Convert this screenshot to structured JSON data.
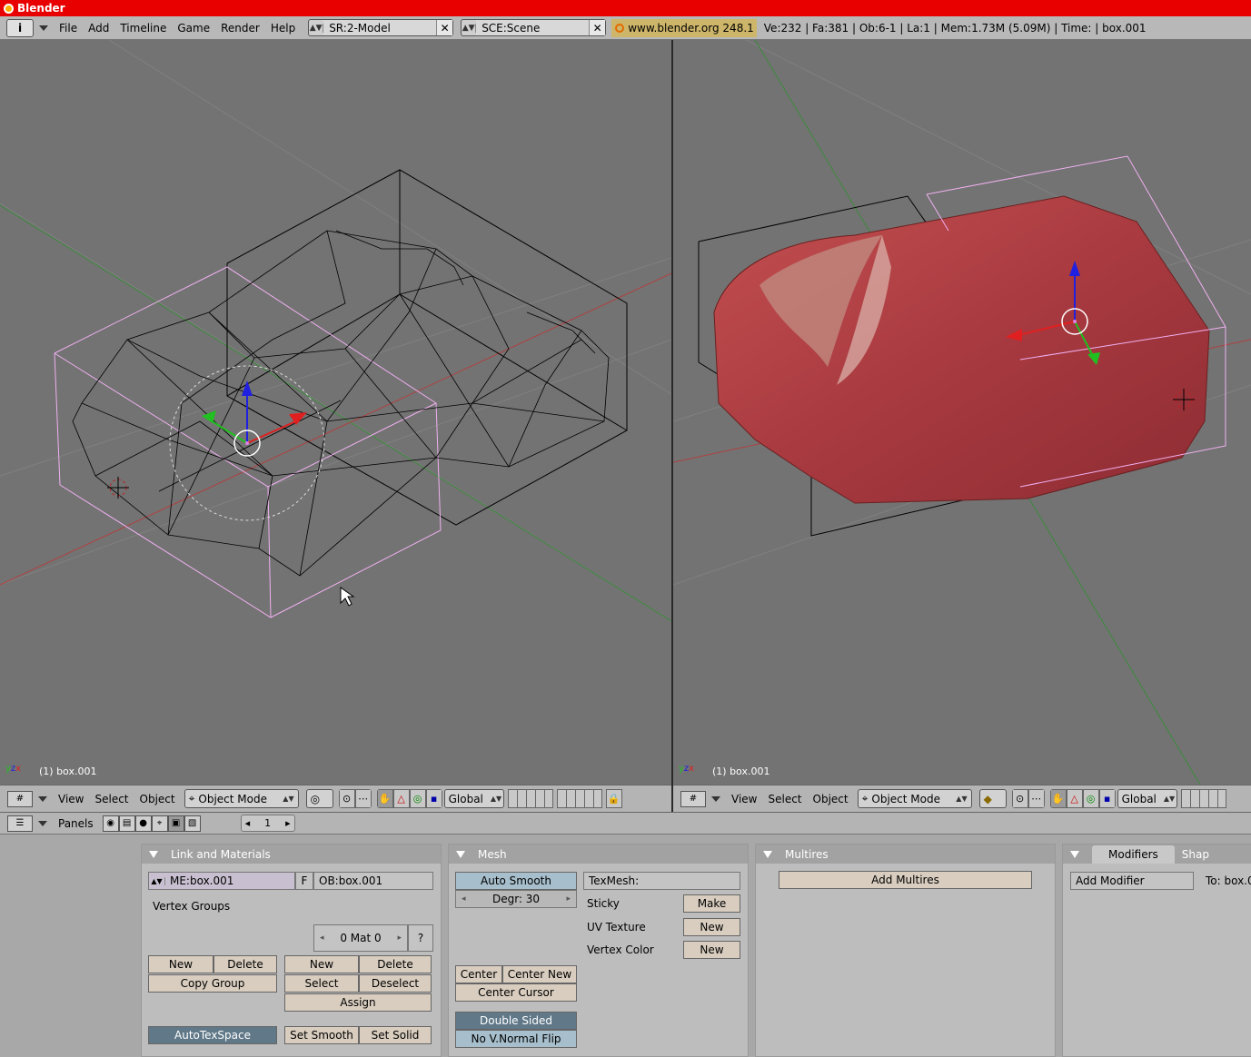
{
  "window": {
    "title": "Blender"
  },
  "info_header": {
    "menus": [
      "File",
      "Add",
      "Timeline",
      "Game",
      "Render",
      "Help"
    ],
    "screen": "SR:2-Model",
    "scene": "SCE:Scene",
    "url": "www.blender.org 248.1",
    "stats": "Ve:232 | Fa:381 | Ob:6-1 | La:1  | Mem:1.73M (5.09M)  | Time: | box.001"
  },
  "viewport_left": {
    "object_label": "(1) box.001",
    "menus": [
      "View",
      "Select",
      "Object"
    ],
    "mode": "Object Mode",
    "orientation": "Global"
  },
  "viewport_right": {
    "object_label": "(1) box.001",
    "menus": [
      "View",
      "Select",
      "Object"
    ],
    "mode": "Object Mode",
    "orientation": "Global"
  },
  "buttons_header": {
    "panels_label": "Panels",
    "frame": "1"
  },
  "link_materials": {
    "title": "Link and Materials",
    "mesh_name": "ME:box.001",
    "fake_user": "F",
    "object_name": "OB:box.001",
    "vertex_groups_label": "Vertex Groups",
    "material_index": "0 Mat 0",
    "help": "?",
    "vg_new": "New",
    "vg_delete": "Delete",
    "copy_group": "Copy Group",
    "mat_new": "New",
    "mat_delete": "Delete",
    "mat_select": "Select",
    "mat_deselect": "Deselect",
    "assign": "Assign",
    "autotexspace": "AutoTexSpace",
    "set_smooth": "Set Smooth",
    "set_solid": "Set Solid"
  },
  "mesh_panel": {
    "title": "Mesh",
    "auto_smooth": "Auto Smooth",
    "degr": "Degr: 30",
    "texmesh": "TexMesh:",
    "sticky": "Sticky",
    "sticky_btn": "Make",
    "uv_texture": "UV Texture",
    "uv_btn": "New",
    "vertex_color": "Vertex Color",
    "vc_btn": "New",
    "center": "Center",
    "center_new": "Center New",
    "center_cursor": "Center Cursor",
    "double_sided": "Double Sided",
    "no_vnormal_flip": "No V.Normal Flip"
  },
  "multires_panel": {
    "title": "Multires",
    "add_multires": "Add Multires"
  },
  "modifiers_panel": {
    "tab_modifiers": "Modifiers",
    "tab_shapes": "Shap",
    "add_modifier": "Add Modifier",
    "to_label": "To: box.0"
  },
  "colors": {
    "titlebar": "#e80000",
    "viewport_bg": "#737373",
    "selected_outline": "#f0b0f0",
    "panel_bg": "#bdbdbd"
  }
}
